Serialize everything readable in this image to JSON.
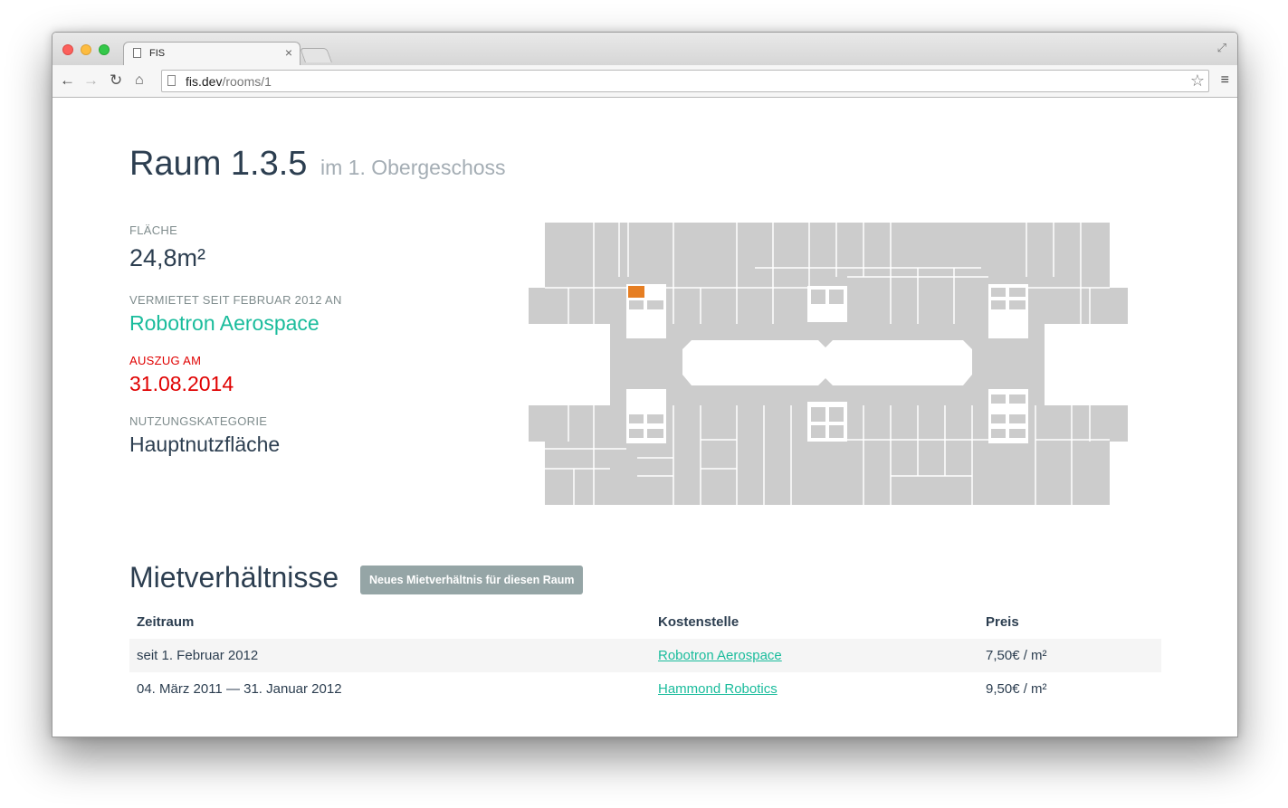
{
  "browser": {
    "tab_title": "FIS",
    "url_host": "fis.dev",
    "url_path": "/rooms/1"
  },
  "room": {
    "title": "Raum 1.3.5",
    "subtitle": "im 1. Obergeschoss",
    "area_label": "Fläche",
    "area_value": "24,8m²",
    "rented_label": "Vermietet seit Februar 2012 an",
    "tenant": "Robotron Aerospace",
    "moveout_label": "Auszug am",
    "moveout_date": "31.08.2014",
    "usage_label": "Nutzungskategorie",
    "usage_value": "Hauptnutzfläche"
  },
  "colors": {
    "primary_text": "#2c3e50",
    "accent": "#1abc9c",
    "danger": "#e00000",
    "muted": "#95a5a6",
    "floorplan_fill": "#cccccc",
    "room_highlight": "#e67e22"
  },
  "rentals": {
    "title": "Mietverhältnisse",
    "new_button": "Neues Mietverhältnis für diesen Raum",
    "columns": [
      "Zeitraum",
      "Kostenstelle",
      "Preis"
    ],
    "rows": [
      {
        "period": "seit 1. Februar 2012",
        "cost_center": "Robotron Aerospace",
        "price": "7,50€ / m²"
      },
      {
        "period": "04. März 2011 — 31. Januar 2012",
        "cost_center": "Hammond Robotics",
        "price": "9,50€ / m²"
      }
    ]
  }
}
